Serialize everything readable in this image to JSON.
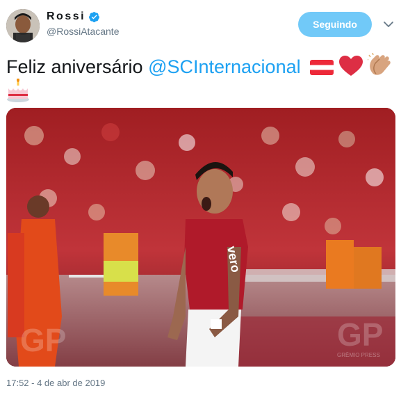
{
  "author": {
    "display_name": "Rossi",
    "handle": "@RossiAtacante",
    "verified": true,
    "avatar_icon": "profile-photo"
  },
  "follow_button": {
    "label": "Seguindo",
    "color": "#71c9f8"
  },
  "menu_icon": "chevron-down-icon",
  "tweet": {
    "text_prefix": "Feliz aniversário ",
    "mention": "@SCInternacional",
    "emojis": [
      "austria-flag-icon",
      "red-heart-icon",
      "clapping-hands-icon",
      "birthday-cake-icon"
    ]
  },
  "media": {
    "watermark_left": "GP",
    "watermark_right": "GP",
    "watermark_caption": "GRÊMIO PRESS",
    "jersey_text": "vero"
  },
  "timestamp": "17:52 - 4 de abr de 2019",
  "colors": {
    "accent": "#1da1f2",
    "text": "#14171a",
    "muted": "#657786"
  }
}
